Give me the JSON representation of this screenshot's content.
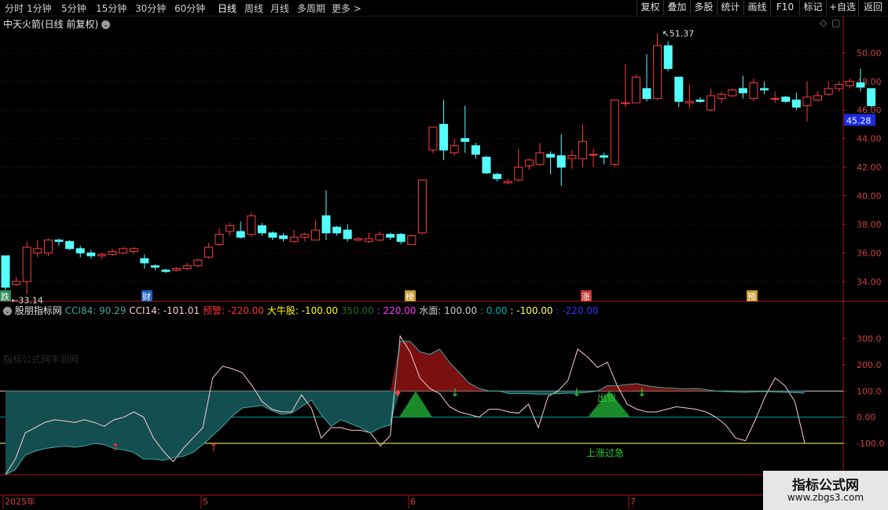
{
  "toolbar": {
    "periods": [
      "分时",
      "1分钟",
      "5分钟",
      "15分钟",
      "30分钟",
      "60分钟",
      "日线",
      "周线",
      "月线",
      "多周期",
      "更多 >"
    ],
    "active": "日线",
    "buttons": [
      "复权",
      "叠加",
      "多股",
      "统计",
      "画线",
      "F10",
      "标记",
      "+自选",
      "返回"
    ]
  },
  "main_chart": {
    "title": "中天火箭(日线 前复权)",
    "price_axis": [
      "50.00",
      "48.00",
      "46.00",
      "44.00",
      "42.00",
      "40.00",
      "38.00",
      "36.00",
      "34.00"
    ],
    "current_price": "45.28",
    "high_label": "51.37",
    "low_label": "33.14",
    "event_tags": [
      "跌",
      "财",
      "榜",
      "涨",
      "预"
    ]
  },
  "indicator": {
    "name": "股朋指标网",
    "values": [
      {
        "text": "CCI84: 90.29",
        "color": "#3fa6a0"
      },
      {
        "text": "CCI14: -101.01",
        "color": "#ffcccc"
      },
      {
        "text": "预警: -220.00",
        "color": "#ff3333"
      },
      {
        "text": "大牛股: -100.00",
        "color": "#ffff00"
      },
      {
        "text": "350.00",
        "color": "#1a6b1a"
      },
      {
        "text": ": 220.00",
        "color": "#ff33ff"
      },
      {
        "text": "水面: 100.00",
        "color": "#cccccc"
      },
      {
        "text": ": 0.00",
        "color": "#00b0b0"
      },
      {
        "text": ": -100.00",
        "color": "#ffff66"
      },
      {
        "text": ": -220.00",
        "color": "#3333ff"
      }
    ],
    "axis": [
      "300.0",
      "200.0",
      "100.0",
      "0.00",
      "-100.0"
    ],
    "label_sell": "出货",
    "label_rise": "上涨过急",
    "watermark": "指标公式网丰测网"
  },
  "date_axis": [
    "2025年",
    "5",
    "6",
    "7"
  ],
  "logo": {
    "text": "指标公式网",
    "url": "www.zbgs3.com"
  },
  "chart_data": {
    "type": "candlestick",
    "title": "中天火箭(日线 前复权)",
    "y_range": [
      33,
      51.5
    ],
    "candles": [
      [
        35.8,
        33.6,
        35.8,
        33.4
      ],
      [
        33.8,
        34.0,
        34.3,
        33.7
      ],
      [
        34.0,
        36.4,
        36.8,
        33.14
      ],
      [
        36.0,
        36.3,
        36.9,
        35.7
      ],
      [
        36.0,
        36.9,
        37.0,
        35.8
      ],
      [
        36.9,
        36.8,
        37.0,
        36.5
      ],
      [
        36.8,
        36.3,
        36.9,
        36.2
      ],
      [
        36.3,
        36.0,
        36.5,
        35.7
      ],
      [
        36.0,
        35.8,
        36.2,
        35.6
      ],
      [
        35.8,
        35.9,
        36.0,
        35.6
      ],
      [
        35.9,
        36.1,
        36.3,
        35.8
      ],
      [
        36.0,
        36.3,
        36.4,
        35.9
      ],
      [
        36.1,
        36.3,
        36.4,
        35.9
      ],
      [
        35.6,
        35.3,
        35.9,
        34.9
      ],
      [
        35.1,
        35.0,
        35.2,
        34.8
      ],
      [
        34.8,
        34.7,
        34.9,
        34.6
      ],
      [
        34.8,
        34.9,
        35.0,
        34.7
      ],
      [
        34.9,
        35.1,
        35.3,
        34.8
      ],
      [
        35.1,
        35.5,
        35.6,
        35.0
      ],
      [
        35.7,
        36.4,
        36.7,
        35.6
      ],
      [
        36.6,
        37.3,
        37.7,
        36.5
      ],
      [
        37.5,
        37.9,
        38.1,
        37.2
      ],
      [
        37.5,
        37.1,
        38.2,
        37.0
      ],
      [
        37.3,
        38.6,
        38.8,
        37.1
      ],
      [
        37.9,
        37.4,
        38.1,
        37.2
      ],
      [
        37.4,
        37.1,
        37.5,
        36.9
      ],
      [
        37.2,
        37.0,
        37.4,
        36.8
      ],
      [
        36.8,
        37.1,
        37.6,
        36.7
      ],
      [
        37.1,
        37.3,
        37.4,
        36.8
      ],
      [
        36.9,
        37.6,
        38.3,
        36.9
      ],
      [
        38.6,
        37.4,
        40.4,
        36.9
      ],
      [
        37.8,
        37.4,
        37.9,
        37.2
      ],
      [
        37.6,
        37.0,
        38.0,
        36.8
      ],
      [
        36.9,
        37.0,
        37.1,
        36.8
      ],
      [
        36.8,
        37.0,
        37.4,
        36.7
      ],
      [
        36.9,
        37.3,
        37.5,
        36.8
      ],
      [
        37.3,
        37.1,
        37.4,
        36.9
      ],
      [
        37.3,
        36.8,
        37.4,
        36.6
      ],
      [
        36.6,
        37.2,
        37.3,
        36.6
      ],
      [
        37.4,
        41.1,
        41.1,
        37.3
      ],
      [
        43.2,
        44.8,
        44.8,
        43.0
      ],
      [
        45.0,
        43.2,
        46.7,
        42.5
      ],
      [
        43.0,
        43.5,
        44.0,
        42.8
      ],
      [
        44.0,
        43.8,
        46.3,
        43.0
      ],
      [
        43.5,
        42.9,
        43.7,
        42.6
      ],
      [
        42.7,
        41.6,
        42.8,
        41.5
      ],
      [
        41.5,
        41.2,
        41.6,
        41.0
      ],
      [
        40.9,
        41.0,
        41.2,
        40.8
      ],
      [
        41.1,
        42.0,
        43.3,
        41.0
      ],
      [
        42.1,
        42.5,
        42.6,
        41.8
      ],
      [
        42.2,
        43.0,
        43.7,
        42.1
      ],
      [
        42.9,
        42.7,
        43.1,
        41.5
      ],
      [
        42.8,
        42.0,
        44.3,
        40.7
      ],
      [
        42.6,
        42.8,
        43.2,
        41.9
      ],
      [
        42.6,
        43.8,
        45.0,
        42.0
      ],
      [
        42.9,
        42.9,
        43.3,
        42.0
      ],
      [
        42.8,
        42.7,
        43.0,
        42.2
      ],
      [
        42.2,
        46.7,
        46.7,
        42.0
      ],
      [
        46.5,
        46.5,
        49.2,
        46.2
      ],
      [
        46.5,
        48.3,
        48.5,
        46.5
      ],
      [
        47.5,
        46.8,
        49.9,
        46.6
      ],
      [
        46.8,
        50.5,
        51.37,
        46.7
      ],
      [
        50.5,
        48.9,
        50.8,
        48.7
      ],
      [
        48.3,
        46.6,
        48.3,
        46.2
      ],
      [
        46.5,
        46.6,
        47.8,
        46.1
      ],
      [
        46.7,
        46.6,
        46.9,
        46.5
      ],
      [
        46.0,
        47.0,
        47.5,
        45.9
      ],
      [
        46.8,
        47.1,
        47.3,
        46.5
      ],
      [
        47.0,
        47.4,
        47.5,
        46.9
      ],
      [
        47.5,
        47.2,
        48.4,
        46.8
      ],
      [
        46.8,
        47.9,
        48.2,
        46.6
      ],
      [
        47.5,
        47.4,
        48.0,
        47.1
      ],
      [
        46.8,
        46.8,
        47.3,
        46.5
      ],
      [
        46.9,
        46.6,
        47.0,
        46.5
      ],
      [
        46.7,
        46.2,
        47.2,
        46.0
      ],
      [
        46.3,
        46.9,
        48.0,
        45.2
      ],
      [
        46.7,
        47.0,
        47.3,
        46.6
      ],
      [
        47.1,
        47.5,
        48.0,
        47.0
      ],
      [
        47.5,
        47.8,
        48.0,
        47.3
      ],
      [
        47.7,
        48.0,
        48.2,
        47.5
      ],
      [
        47.9,
        47.6,
        48.9,
        47.3
      ],
      [
        47.5,
        46.3,
        47.5,
        46.2
      ]
    ],
    "oscillator": {
      "y_range": [
        -220,
        380
      ],
      "cci84": [
        -220,
        -200,
        -145,
        -130,
        -120,
        -115,
        -110,
        -115,
        -110,
        -100,
        -105,
        -120,
        -125,
        -135,
        -160,
        -160,
        -165,
        -155,
        -150,
        -135,
        -105,
        -70,
        -35,
        5,
        35,
        40,
        45,
        25,
        10,
        15,
        40,
        65,
        10,
        -35,
        -10,
        -25,
        -40,
        -60,
        -40,
        -30,
        290,
        290,
        250,
        240,
        260,
        210,
        170,
        130,
        110,
        100,
        100,
        90,
        90,
        90,
        88,
        88,
        90,
        92,
        92,
        95,
        100,
        120,
        120,
        125,
        128,
        120,
        115,
        112,
        110,
        108,
        110,
        105,
        100,
        98,
        96,
        95,
        97,
        98,
        96,
        95,
        94,
        92
      ],
      "cci14": [
        -220,
        -160,
        -60,
        -40,
        -20,
        -10,
        -15,
        -20,
        -10,
        -20,
        -35,
        -10,
        0,
        20,
        0,
        -80,
        -130,
        -170,
        -120,
        -80,
        -40,
        150,
        195,
        185,
        170,
        120,
        60,
        30,
        20,
        20,
        85,
        35,
        -80,
        -40,
        -40,
        -50,
        -50,
        -60,
        -110,
        -70,
        310,
        250,
        150,
        110,
        90,
        40,
        20,
        10,
        0,
        30,
        30,
        20,
        15,
        50,
        -40,
        80,
        100,
        140,
        260,
        230,
        190,
        210,
        120,
        50,
        30,
        20,
        20,
        30,
        40,
        35,
        30,
        20,
        0,
        -30,
        -80,
        -90,
        -10,
        80,
        150,
        120,
        60,
        -100
      ]
    }
  }
}
